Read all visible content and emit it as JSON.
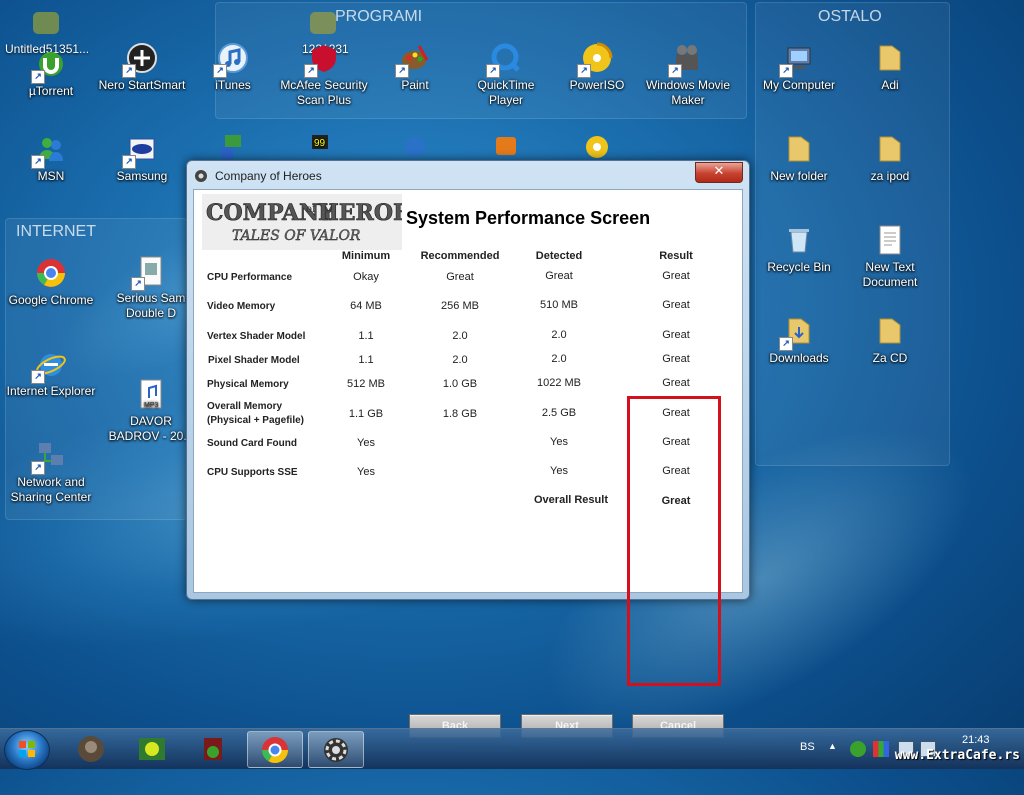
{
  "desktop": {
    "fences": {
      "programi": "PROGRAMI",
      "ostalo": "OSTALO",
      "internet": "INTERNET"
    },
    "top_labels": {
      "left": "Untitled51351...",
      "middle": "1231231"
    },
    "icons": {
      "utorrent": "µTorrent",
      "nero": "Nero StartSmart",
      "itunes": "iTunes",
      "mcafee_line1": "McAfee Security",
      "mcafee_line2": "Scan Plus",
      "paint": "Paint",
      "quicktime_line1": "QuickTime",
      "quicktime_line2": "Player",
      "poweriso": "PowerISO",
      "moviemaker_line1": "Windows Movie",
      "moviemaker_line2": "Maker",
      "mycomputer": "My Computer",
      "adi": "Adi",
      "msn": "MSN",
      "samsung": "Samsung",
      "newfolder": "New folder",
      "zaipod": "za ipod",
      "chrome": "Google Chrome",
      "serioussam_line1": "Serious Sam",
      "serioussam_line2": "Double D",
      "recyclebin": "Recycle Bin",
      "newtext_line1": "New Text",
      "newtext_line2": "Document",
      "ie": "Internet Explorer",
      "downloads": "Downloads",
      "zacd": "Za  CD",
      "davor_line1": "DAVOR",
      "davor_line2": "BADROV - 20...",
      "network_line1": "Network and",
      "network_line2": "Sharing Center"
    }
  },
  "dialog": {
    "window_title": "Company of Heroes",
    "close_symbol": "✕",
    "logo_line1": "COMPANY of HEROES",
    "logo_line2": "TALES OF VALOR",
    "screen_title": "System Performance Screen",
    "headers": {
      "minimum": "Minimum",
      "recommended": "Recommended",
      "detected": "Detected",
      "result": "Result"
    },
    "rows": [
      {
        "label": "CPU Performance",
        "minimum": "Okay",
        "recommended": "Great",
        "detected": "Great",
        "result": "Great"
      },
      {
        "label": "Video Memory",
        "minimum": "64 MB",
        "recommended": "256 MB",
        "detected": "510 MB",
        "result": "Great"
      },
      {
        "label": "Vertex Shader Model",
        "minimum": "1.1",
        "recommended": "2.0",
        "detected": "2.0",
        "result": "Great"
      },
      {
        "label": "Pixel Shader Model",
        "minimum": "1.1",
        "recommended": "2.0",
        "detected": "2.0",
        "result": "Great"
      },
      {
        "label": "Physical Memory",
        "minimum": "512 MB",
        "recommended": "1.0 GB",
        "detected": "1022 MB",
        "result": "Great"
      },
      {
        "label": "Overall Memory",
        "label2": "(Physical + Pagefile)",
        "minimum": "1.1 GB",
        "recommended": "1.8 GB",
        "detected": "2.5 GB",
        "result": "Great"
      },
      {
        "label": "Sound Card Found",
        "minimum": "Yes",
        "recommended": "",
        "detected": "Yes",
        "result": "Great"
      },
      {
        "label": "CPU Supports SSE",
        "minimum": "Yes",
        "recommended": "",
        "detected": "Yes",
        "result": "Great"
      }
    ],
    "overall_label": "Overall Result",
    "overall_value": "Great",
    "buttons": {
      "back": "Back",
      "next": "Next",
      "cancel": "Cancel"
    }
  },
  "taskbar": {
    "language": "BS",
    "time": "21:43",
    "tray_expand": "▲"
  },
  "watermark": "www.ExtraCafe.rs",
  "colors": {
    "highlight_border": "#d4101c",
    "close_button": "#c84230"
  }
}
